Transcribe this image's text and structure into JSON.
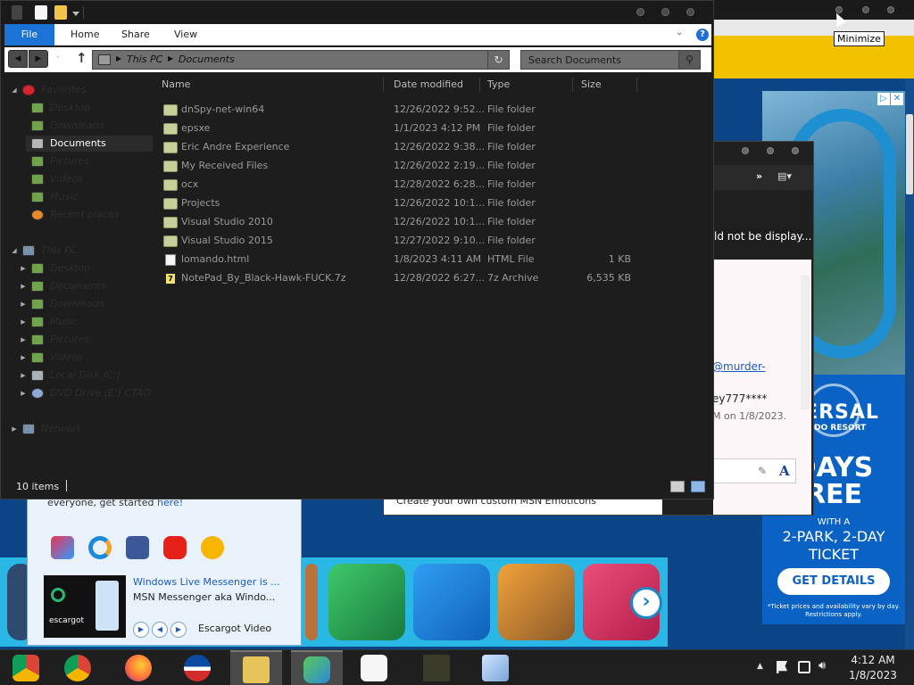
{
  "explorer": {
    "ribbon_tabs": [
      "File",
      "Home",
      "Share",
      "View"
    ],
    "address": {
      "crumb1": "This PC",
      "crumb2": "Documents"
    },
    "search_placeholder": "Search Documents",
    "columns": {
      "name": "Name",
      "date": "Date modified",
      "type": "Type",
      "size": "Size"
    },
    "files": [
      {
        "name": "dnSpy-net-win64",
        "date": "12/26/2022 9:52...",
        "type": "File folder",
        "size": "",
        "icon": "folder-icon"
      },
      {
        "name": "epsxe",
        "date": "1/1/2023 4:12 PM",
        "type": "File folder",
        "size": "",
        "icon": "folder-icon"
      },
      {
        "name": "Eric Andre Experience",
        "date": "12/26/2022 9:38...",
        "type": "File folder",
        "size": "",
        "icon": "folder-icon"
      },
      {
        "name": "My Received Files",
        "date": "12/26/2022 2:19...",
        "type": "File folder",
        "size": "",
        "icon": "folder-icon"
      },
      {
        "name": "ocx",
        "date": "12/28/2022 6:28...",
        "type": "File folder",
        "size": "",
        "icon": "folder-icon"
      },
      {
        "name": "Projects",
        "date": "12/26/2022 10:1...",
        "type": "File folder",
        "size": "",
        "icon": "folder-icon"
      },
      {
        "name": "Visual Studio 2010",
        "date": "12/26/2022 10:1...",
        "type": "File folder",
        "size": "",
        "icon": "folder-icon"
      },
      {
        "name": "Visual Studio 2015",
        "date": "12/27/2022 9:10...",
        "type": "File folder",
        "size": "",
        "icon": "folder-icon"
      },
      {
        "name": "lomando.html",
        "date": "1/8/2023 4:11 AM",
        "type": "HTML File",
        "size": "1 KB",
        "icon": "html-file-icon"
      },
      {
        "name": "NotePad_By_Black-Hawk-FUCK.7z",
        "date": "12/28/2022 6:27...",
        "type": "7z Archive",
        "size": "6,535 KB",
        "icon": "archive-file-icon"
      }
    ],
    "sidebar": {
      "favorites": "Favorites",
      "fav_items": [
        "Desktop",
        "Downloads",
        "Documents",
        "Pictures",
        "Videos",
        "Music",
        "Recent places"
      ],
      "this_pc": "This PC",
      "pc_items": [
        "Desktop",
        "Documents",
        "Downloads",
        "Music",
        "Pictures",
        "Videos",
        "Local Disk (C:)",
        "DVD Drive (E:) CTAO"
      ],
      "network": "Network"
    },
    "status": "10 items"
  },
  "tooltip": "Minimize",
  "chat": {
    "error_text": "ld not be display...",
    "link_text": "@murder-",
    "password_text": "ey777****",
    "timestamp": "M on 1/8/2023.",
    "footer_text": "Create your own custom MSN Emoticons"
  },
  "msn": {
    "tagline_prefix": "everyone, get started ",
    "tagline_link": "here!",
    "video_title": "Windows Live Messenger is ...",
    "video_sub": "MSN Messenger aka Windo...",
    "video_channel": "Escargot Video",
    "thumb_label": "escargot"
  },
  "ad": {
    "brand": "VERSAL",
    "brand_sub": "ANDO RESORT",
    "headline1": "DAYS",
    "headline2": "REE",
    "with_text": "WITH A",
    "offer1": "2-PARK, 2-DAY",
    "offer2": "TICKET",
    "cta": "GET DETAILS",
    "fine1": "*Ticket prices and availability vary by day.",
    "fine2": "Restrictions apply."
  },
  "clock": {
    "time": "4:12 AM",
    "date": "1/8/2023"
  },
  "colors": {
    "accent": "#1d72d6",
    "window_bg": "#1d1d1d",
    "taskbar": "#1f1f1f",
    "ad_blue": "#0a62c4"
  }
}
